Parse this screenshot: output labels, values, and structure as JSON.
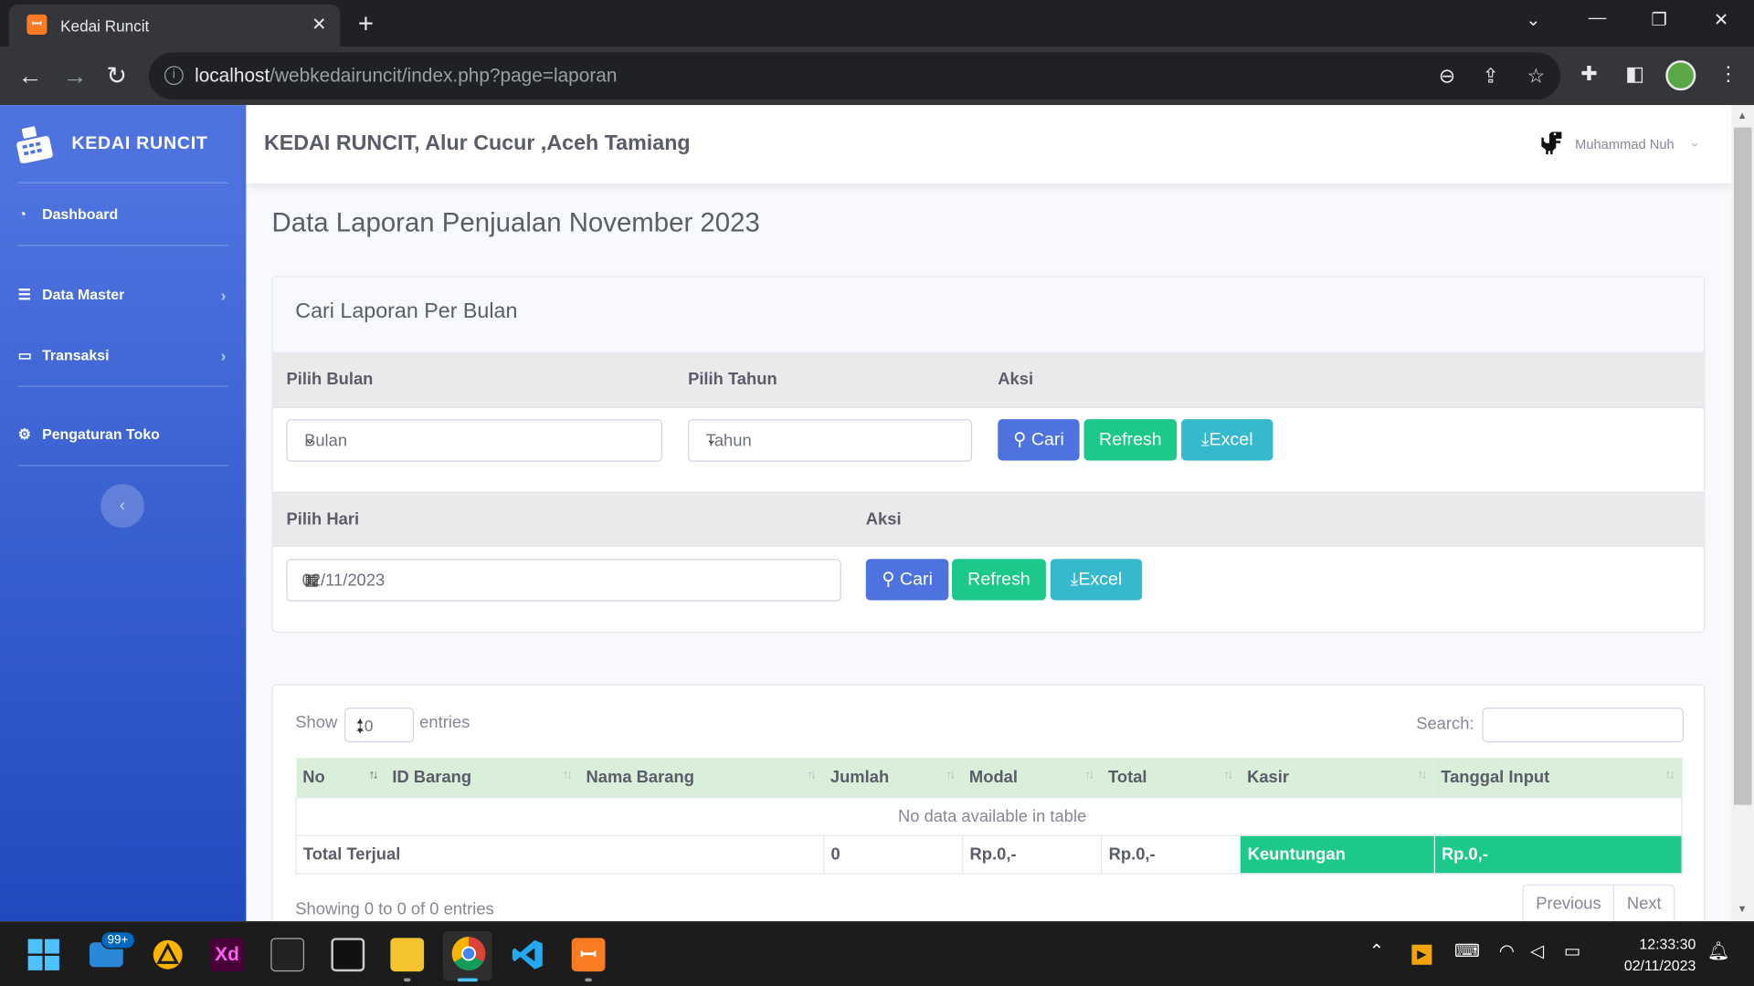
{
  "browser": {
    "tab_title": "Kedai Runcit",
    "favicon_glyph": "ꟷ",
    "url_host": "localhost",
    "url_path": "/webkedairuncit/index.php?page=laporan",
    "close_tab": "✕",
    "new_tab": "+"
  },
  "sidebar": {
    "brand": "KEDAI RUNCIT",
    "items": [
      {
        "label": "Dashboard",
        "icon": "tachometer-icon"
      },
      {
        "label": "Data Master",
        "icon": "database-icon"
      },
      {
        "label": "Transaksi",
        "icon": "desktop-icon"
      },
      {
        "label": "Pengaturan Toko",
        "icon": "cogs-icon"
      }
    ],
    "toggle_glyph": "‹"
  },
  "topbar": {
    "store_name": "KEDAI RUNCIT, Alur Cucur ,Aceh Tamiang",
    "user_name": "Muhammad Nuh"
  },
  "page": {
    "title": "Data Laporan Penjualan November 2023"
  },
  "search_card": {
    "header": "Cari Laporan Per Bulan",
    "month_section": {
      "col_month": "Pilih Bulan",
      "col_year": "Pilih Tahun",
      "col_action": "Aksi",
      "month_value": "Bulan",
      "year_value": "Tahun"
    },
    "day_section": {
      "col_day": "Pilih Hari",
      "col_action": "Aksi",
      "date_value": "02/11/2023"
    },
    "buttons": {
      "search": "Cari",
      "refresh": "Refresh",
      "excel": "Excel"
    }
  },
  "table_card": {
    "show_label": "Show",
    "length_value": "10",
    "entries_label": "entries",
    "search_label": "Search:",
    "columns": [
      "No",
      "ID Barang",
      "Nama Barang",
      "Jumlah",
      "Modal",
      "Total",
      "Kasir",
      "Tanggal Input"
    ],
    "empty_message": "No data available in table",
    "totals": {
      "label": "Total Terjual",
      "jumlah": "0",
      "modal": "Rp.0,-",
      "total": "Rp.0,-",
      "profit_label": "Keuntungan",
      "profit_value": "Rp.0,-"
    },
    "info": "Showing 0 to 0 of 0 entries",
    "prev": "Previous",
    "next": "Next"
  },
  "taskbar": {
    "mail_badge": "99+",
    "time": "12:33:30",
    "date": "02/11/2023"
  },
  "colors": {
    "sidebar_start": "#4e73df",
    "sidebar_end": "#224abe",
    "primary": "#4e73df",
    "success": "#1cc88a",
    "info": "#36b9cc",
    "table_header": "#d9efd9"
  }
}
